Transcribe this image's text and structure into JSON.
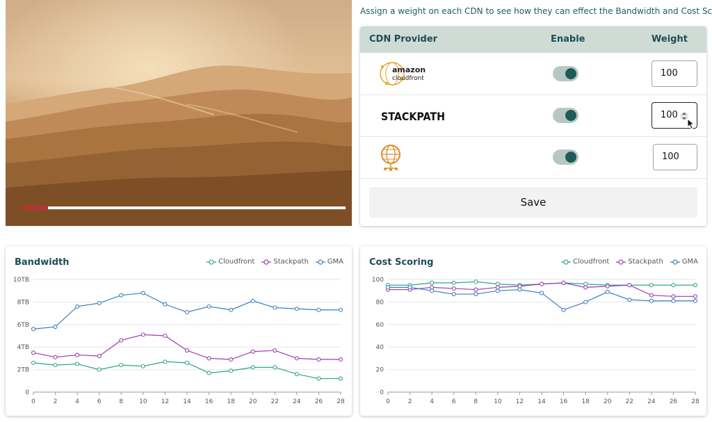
{
  "intro_text": "Assign a weight on each CDN to see how they can effect the Bandwidth and Cost Scoring",
  "video": {
    "progress": 0.08
  },
  "cdn_table": {
    "headers": {
      "provider": "CDN Provider",
      "enable": "Enable",
      "weight": "Weight"
    },
    "rows": [
      {
        "logo": "amazon-cloudfront-logo",
        "logo_text_1": "amazon",
        "logo_text_2": "cloudfront",
        "enabled": true,
        "weight": "100"
      },
      {
        "logo": "stackpath-logo",
        "logo_text_1": "STACKPATH",
        "enabled": true,
        "weight": "100"
      },
      {
        "logo": "gma-globe-logo",
        "enabled": true,
        "weight": "100"
      }
    ],
    "save_label": "Save"
  },
  "colors": {
    "cloudfront": "#2aa58c",
    "stackpath": "#9b3db0",
    "gma": "#3a7fbd"
  },
  "chart_data": [
    {
      "type": "line",
      "title": "Bandwidth",
      "x": [
        0,
        2,
        4,
        6,
        8,
        10,
        12,
        14,
        16,
        18,
        20,
        22,
        24,
        26,
        28
      ],
      "x_ticks": [
        "0",
        "2",
        "4",
        "6",
        "8",
        "10",
        "12",
        "14",
        "16",
        "18",
        "20",
        "22",
        "24",
        "26",
        "28"
      ],
      "y_ticks": [
        "0",
        "2TB",
        "4TB",
        "6TB",
        "8TB",
        "10TB"
      ],
      "ylim": [
        0,
        10
      ],
      "grid": true,
      "legend": "top-right",
      "series": [
        {
          "name": "Cloudfront",
          "values": [
            2.6,
            2.4,
            2.5,
            2.0,
            2.4,
            2.3,
            2.7,
            2.6,
            1.7,
            1.9,
            2.2,
            2.2,
            1.6,
            1.2,
            1.2
          ]
        },
        {
          "name": "Stackpath",
          "values": [
            3.5,
            3.1,
            3.3,
            3.2,
            4.6,
            5.1,
            5.0,
            3.7,
            3.0,
            2.9,
            3.6,
            3.7,
            3.0,
            2.9,
            2.9
          ]
        },
        {
          "name": "GMA",
          "values": [
            5.6,
            5.8,
            7.6,
            7.9,
            8.6,
            8.8,
            7.8,
            7.1,
            7.6,
            7.3,
            8.1,
            7.5,
            7.4,
            7.3,
            7.3
          ]
        }
      ]
    },
    {
      "type": "line",
      "title": "Cost Scoring",
      "x": [
        0,
        2,
        4,
        6,
        8,
        10,
        12,
        14,
        16,
        18,
        20,
        22,
        24,
        26,
        28
      ],
      "x_ticks": [
        "0",
        "2",
        "4",
        "6",
        "8",
        "10",
        "12",
        "14",
        "16",
        "18",
        "20",
        "22",
        "24",
        "26",
        "28"
      ],
      "y_ticks": [
        "0",
        "20",
        "40",
        "60",
        "80",
        "100"
      ],
      "ylim": [
        0,
        100
      ],
      "grid": true,
      "legend": "top-right",
      "series": [
        {
          "name": "Cloudfront",
          "values": [
            95,
            95,
            97,
            97,
            98,
            96,
            95,
            96,
            97,
            96,
            95,
            95,
            95,
            95,
            95
          ]
        },
        {
          "name": "Stackpath",
          "values": [
            91,
            91,
            93,
            92,
            91,
            93,
            94,
            96,
            97,
            93,
            94,
            95,
            86,
            85,
            85
          ]
        },
        {
          "name": "GMA",
          "values": [
            93,
            93,
            90,
            87,
            87,
            90,
            91,
            88,
            73,
            80,
            89,
            82,
            81,
            81,
            81
          ]
        }
      ]
    }
  ]
}
